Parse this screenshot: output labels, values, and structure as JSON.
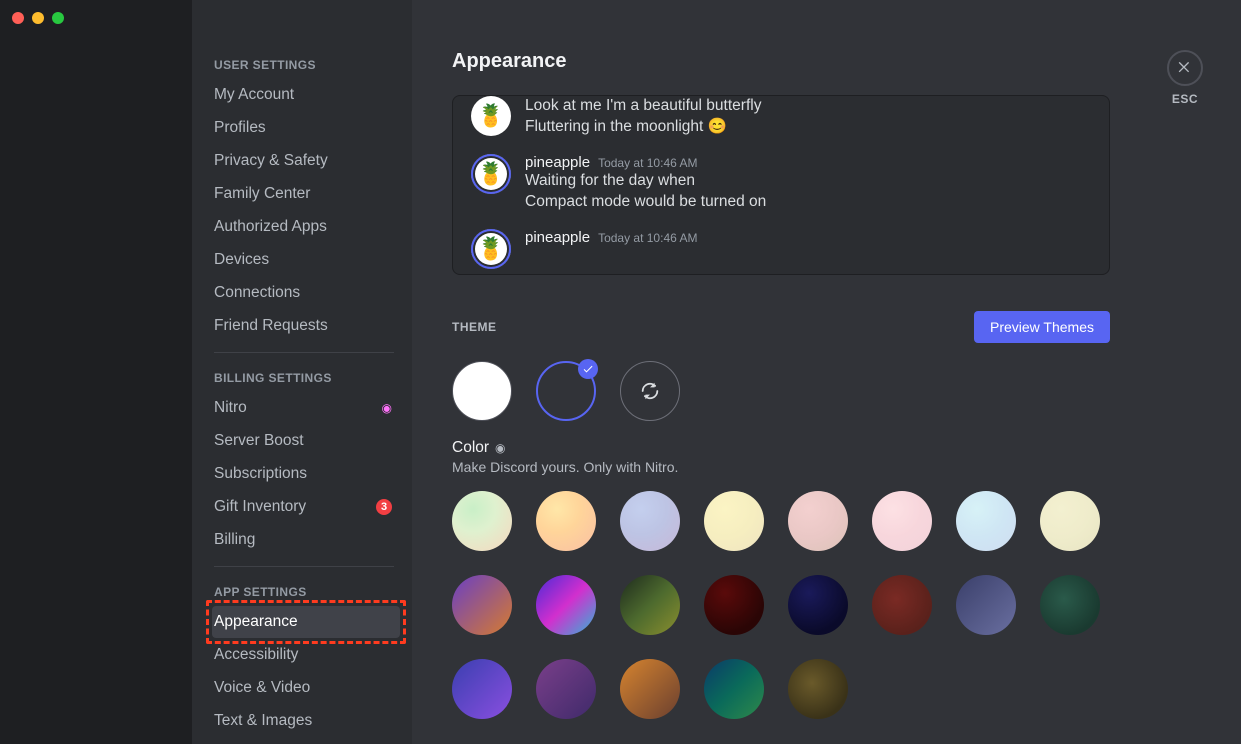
{
  "sidebar": {
    "cat_user": "USER SETTINGS",
    "items_user": [
      {
        "label": "My Account"
      },
      {
        "label": "Profiles"
      },
      {
        "label": "Privacy & Safety"
      },
      {
        "label": "Family Center"
      },
      {
        "label": "Authorized Apps"
      },
      {
        "label": "Devices"
      },
      {
        "label": "Connections"
      },
      {
        "label": "Friend Requests"
      }
    ],
    "cat_billing": "BILLING SETTINGS",
    "items_billing": [
      {
        "label": "Nitro"
      },
      {
        "label": "Server Boost"
      },
      {
        "label": "Subscriptions"
      },
      {
        "label": "Gift Inventory"
      },
      {
        "label": "Billing"
      }
    ],
    "gift_badge": "3",
    "cat_app": "APP SETTINGS",
    "items_app": [
      {
        "label": "Appearance"
      },
      {
        "label": "Accessibility"
      },
      {
        "label": "Voice & Video"
      },
      {
        "label": "Text & Images"
      }
    ]
  },
  "page": {
    "title": "Appearance",
    "esc": "ESC"
  },
  "preview": {
    "msg_top_line1": "Look at me I'm a beautiful butterfly",
    "msg_top_line2": "Fluttering in the moonlight 😊",
    "user": "pineapple",
    "ts": "Today at 10:46 AM",
    "msg2_line1": "Waiting for the day when",
    "msg2_line2": "Compact mode would be turned on"
  },
  "theme": {
    "title": "THEME",
    "button": "Preview Themes",
    "color_title": "Color",
    "color_desc": "Make Discord yours. Only with Nitro."
  },
  "swatches_row1": [
    "radial-gradient(circle at 35% 30%, #c9efc7, #dff1cf 40%, #f6d7be 100%)",
    "radial-gradient(circle at 35% 30%, #ffe7a8, #ffd59a 40%, #f9bfa3 100%)",
    "radial-gradient(circle at 35% 30%, #c4cfee, #bdc4e4 45%, #c7b8d8 100%)",
    "radial-gradient(circle at 35% 30%, #fbf4c4, #f6eec0 50%, #efe4c1 100%)",
    "radial-gradient(circle at 35% 30%, #f3d0cf, #eac8c6 50%, #dcc2b8 100%)",
    "radial-gradient(circle at 35% 30%, #fde1e4, #f7d6dc 50%, #f2d3da 100%)",
    "radial-gradient(circle at 35% 30%, #d7f2f7, #cfe6f4 50%, #cfddf1 100%)",
    "radial-gradient(circle at 35% 30%, #f3f0d0, #efeccb 50%, #e8e4c3 100%)"
  ],
  "swatches_row2": [
    "linear-gradient(135deg,#6a3fc4 0%,#d67b2f 100%)",
    "linear-gradient(135deg,#4a2ad6 0%,#d22fce 50%,#2fb7d6 100%)",
    "linear-gradient(135deg,#1d2a1d 0%,#4d6a2e 50%,#8a8f2f 100%)",
    "radial-gradient(circle at 35% 30%,#5a0a0a,#2a0505 70%)",
    "radial-gradient(circle at 35% 30%,#1a1a5a,#0a0a2a 70%)",
    "radial-gradient(circle at 40% 40%,#7a2a24,#5a211b 70%)",
    "linear-gradient(135deg,#3a3f6a 0%,#6a6fa0 100%)",
    "radial-gradient(circle at 40% 40%,#2a5a4a,#1a3a30 70%)"
  ],
  "swatches_row3": [
    "linear-gradient(135deg,#3a3fb0 0%,#8a4fe0 100%)",
    "linear-gradient(135deg,#7a3f8a 0%,#3f2a6a 100%)",
    "linear-gradient(135deg,#d6842f 0%,#6a3f2f 100%)",
    "linear-gradient(135deg,#0a3a6a 0%,#0a6a5a 50%,#2f8a4a 100%)",
    "radial-gradient(circle at 40% 40%,#6a5a2a,#3a3218 70%)"
  ]
}
